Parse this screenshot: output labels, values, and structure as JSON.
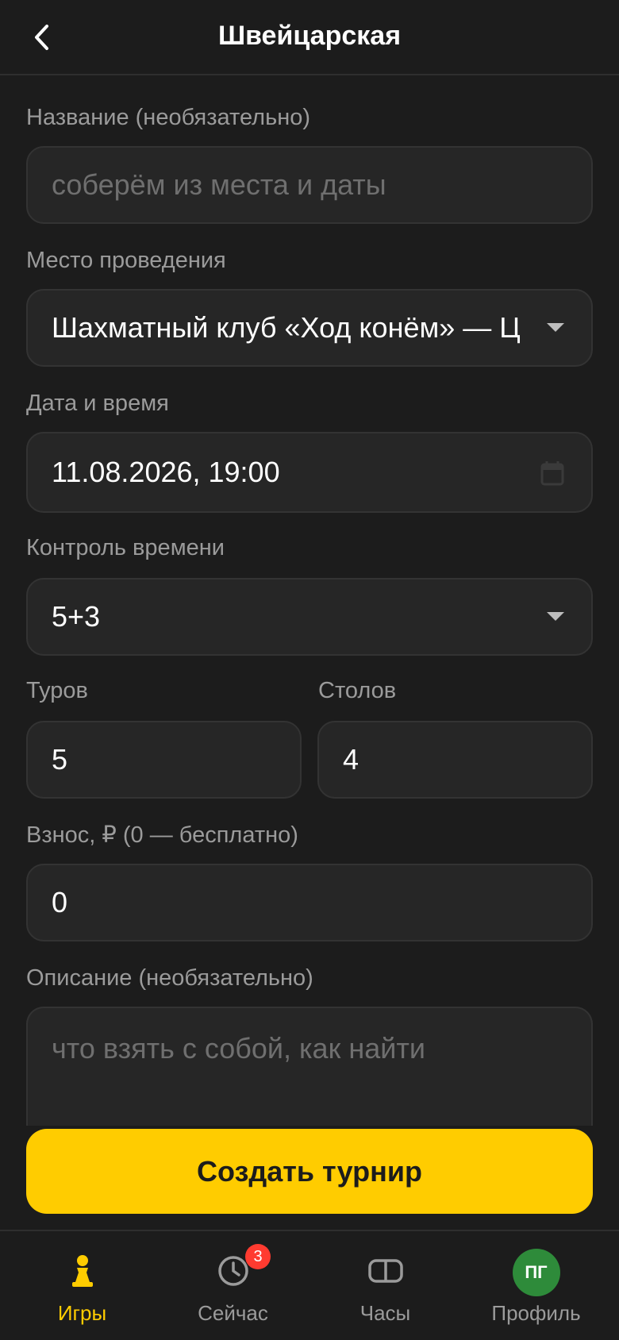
{
  "header": {
    "title": "Швейцарская"
  },
  "form": {
    "name_label": "Название (необязательно)",
    "name_placeholder": "соберём из места и даты",
    "venue_label": "Место проведения",
    "venue_value": "Шахматный клуб «Ход конём» — Ц",
    "datetime_label": "Дата и время",
    "datetime_value": "11.08.2026, 19:00",
    "time_control_label": "Контроль времени",
    "time_control_value": "5+3",
    "rounds_label": "Туров",
    "rounds_value": "5",
    "tables_label": "Столов",
    "tables_value": "4",
    "fee_label": "Взнос, ₽ (0 — бесплатно)",
    "fee_value": "0",
    "description_label": "Описание (необязательно)",
    "description_placeholder": "что взять с собой, как найти"
  },
  "cta": {
    "label": "Создать турнир"
  },
  "tabbar": {
    "games": "Игры",
    "now": "Сейчас",
    "now_badge": "3",
    "clock": "Часы",
    "profile": "Профиль",
    "avatar_initials": "ПГ"
  },
  "colors": {
    "accent": "#ffcc00",
    "background": "#1c1c1c",
    "badge": "#ff3b30",
    "avatar": "#2e8b3a"
  }
}
